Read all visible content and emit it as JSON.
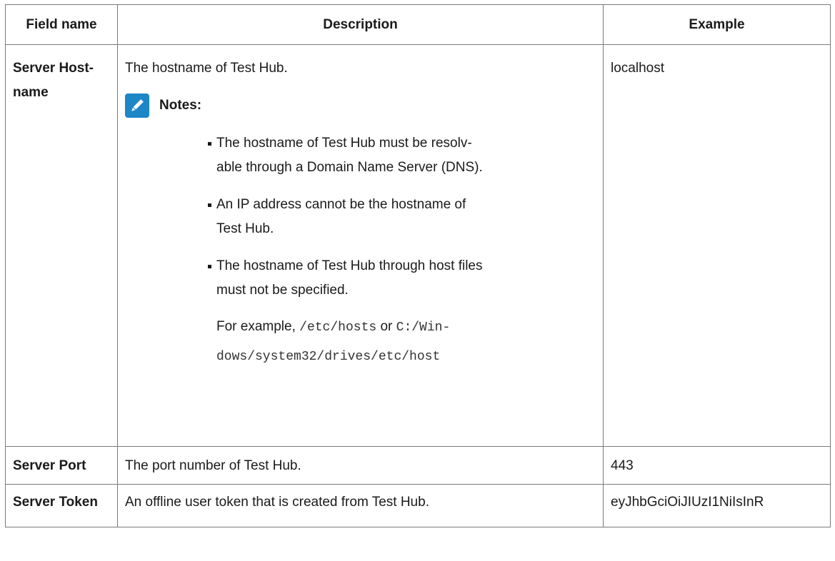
{
  "table": {
    "headers": [
      "Field name",
      "Description",
      "Example"
    ],
    "rows": [
      {
        "field": "Server Host-\nname",
        "description": "The hostname of Test Hub.",
        "notes_title": "Notes:",
        "notes": [
          "The hostname of Test Hub must be resolv-\nable through a Domain Name Server (DNS).",
          "An IP address cannot be the hostname of\nTest Hub.",
          "The hostname of Test Hub through host files\nmust not be specified."
        ],
        "example_prefix": "For example,",
        "example_code_1": "/etc/hosts",
        "example_or": "or",
        "example_code_2a": "C:/Win-",
        "example_code_2b": "dows/system32/drives/etc/host",
        "example": "localhost"
      },
      {
        "field": "Server Port",
        "description": "The port number of Test Hub.",
        "example": "443"
      },
      {
        "field": "Server Token",
        "description": "An offline user token that is created from Test Hub.",
        "example": "eyJhbGciOiJIUzI1NiIsInR"
      }
    ]
  },
  "icons": {
    "notes": "pencil-icon"
  },
  "colors": {
    "note_icon_bg": "#1c86c6",
    "border": "#7a7a7a"
  }
}
